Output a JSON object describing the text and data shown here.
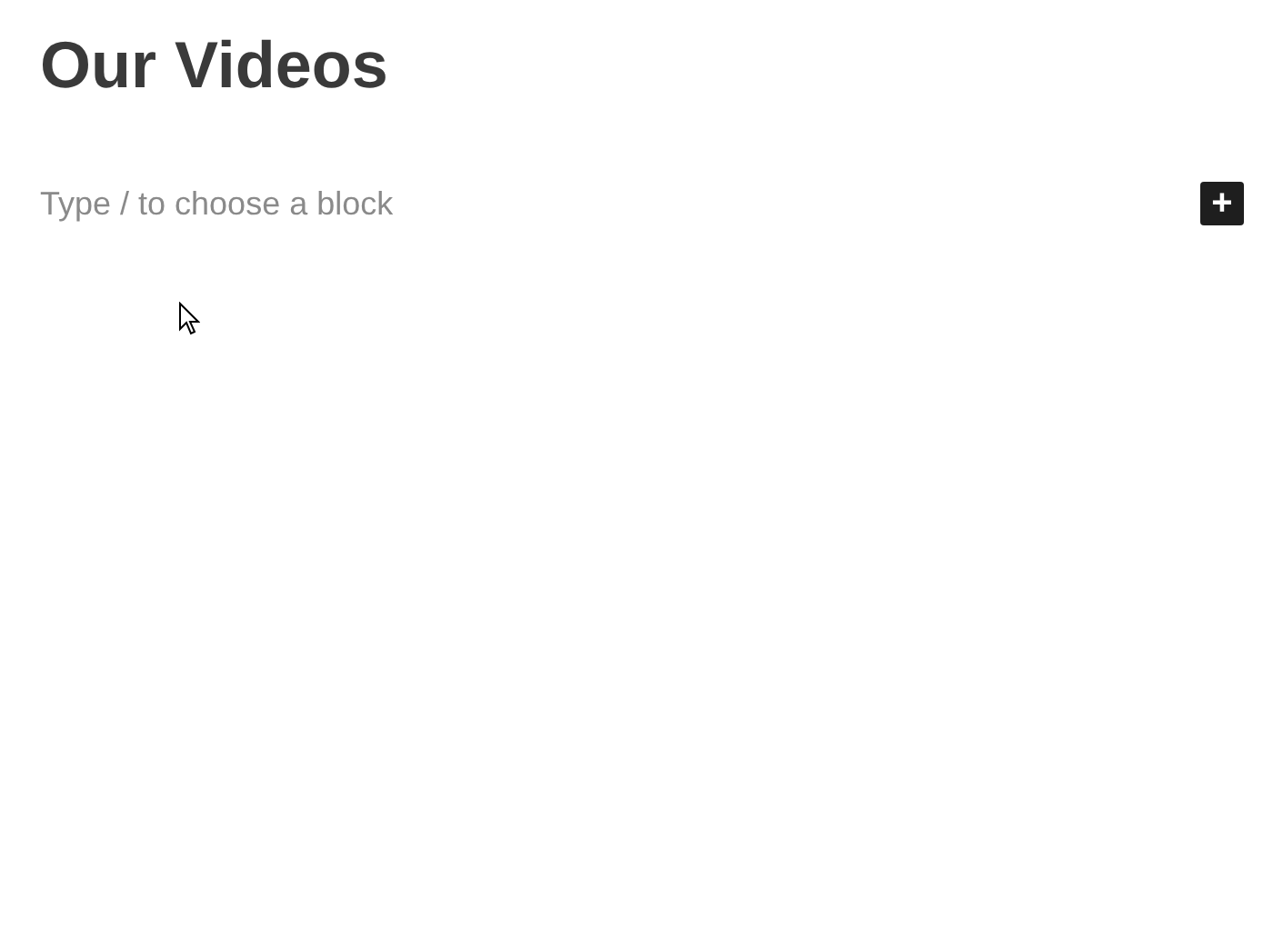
{
  "page": {
    "title": "Our Videos"
  },
  "block_input": {
    "placeholder": "Type / to choose a block"
  },
  "add_block_button": {
    "label": "+"
  }
}
